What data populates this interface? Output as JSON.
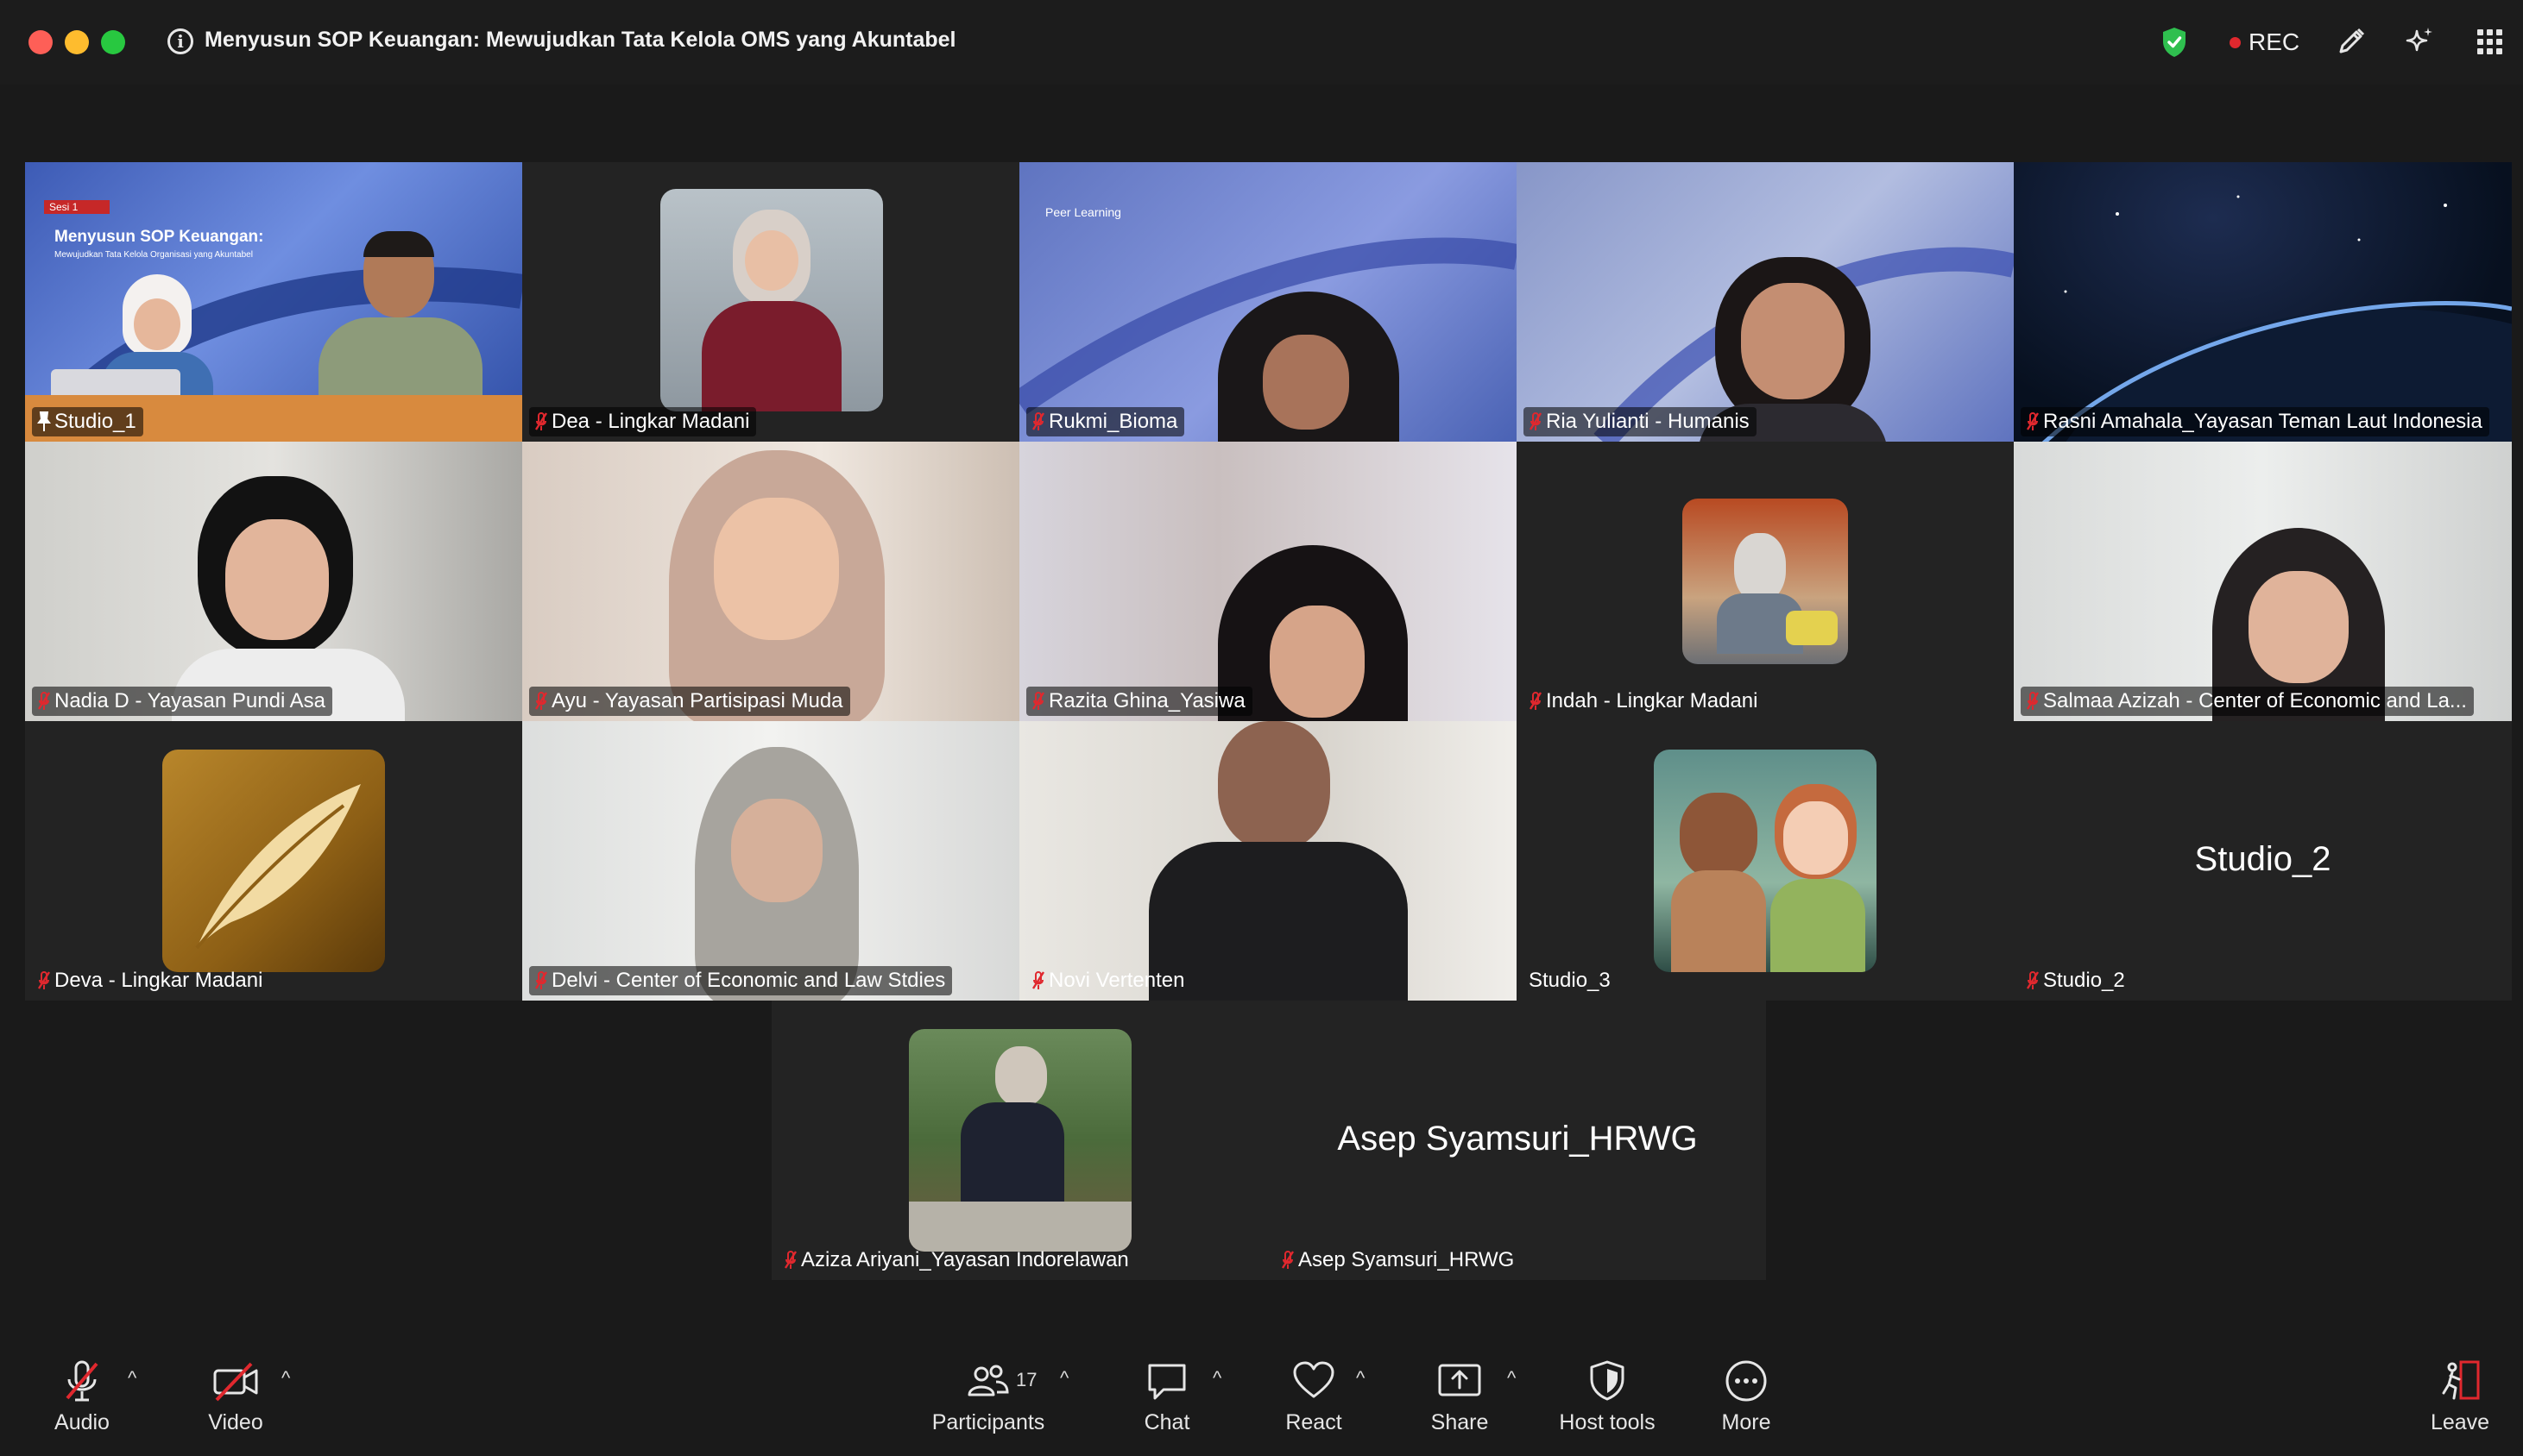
{
  "window": {
    "title": "Menyusun SOP Keuangan: Mewujudkan Tata Kelola OMS yang Akuntabel",
    "rec_label": "REC"
  },
  "participants": [
    {
      "name": "Studio_1",
      "muted": false,
      "pinned": true
    },
    {
      "name": "Dea - Lingkar Madani",
      "muted": true
    },
    {
      "name": "Rukmi_Bioma",
      "muted": true
    },
    {
      "name": "Ria Yulianti - Humanis",
      "muted": true
    },
    {
      "name": "Rasni Amahala_Yayasan Teman Laut Indonesia",
      "muted": true
    },
    {
      "name": "Nadia D - Yayasan Pundi Asa",
      "muted": true
    },
    {
      "name": "Ayu - Yayasan Partisipasi Muda",
      "muted": true
    },
    {
      "name": "Razita Ghina_Yasiwa",
      "muted": true
    },
    {
      "name": "Indah - Lingkar Madani",
      "muted": true
    },
    {
      "name": "Salmaa Azizah - Center of Economic and La...",
      "muted": true
    },
    {
      "name": "Deva - Lingkar Madani",
      "muted": true
    },
    {
      "name": "Delvi - Center of Economic and Law Stdies",
      "muted": true
    },
    {
      "name": "Novi Vertenten",
      "muted": true
    },
    {
      "name": "Studio_3",
      "muted": false
    },
    {
      "name": "Studio_2",
      "muted": true,
      "display_name": "Studio_2"
    },
    {
      "name": "Aziza Ariyani_Yayasan Indorelawan",
      "muted": true
    },
    {
      "name": "Asep Syamsuri_HRWG",
      "muted": true,
      "display_name": "Asep Syamsuri_HRWG"
    }
  ],
  "slides": {
    "studio1_session": "Sesi 1",
    "studio1_heading": "Menyusun SOP Keuangan:",
    "studio1_sub": "Mewujudkan Tata Kelola Organisasi yang Akuntabel",
    "peer_learning": "Peer Learning"
  },
  "toolbar": {
    "audio": "Audio",
    "video": "Video",
    "participants": "Participants",
    "participants_count": "17",
    "chat": "Chat",
    "react": "React",
    "share": "Share",
    "host_tools": "Host tools",
    "more": "More",
    "leave": "Leave",
    "caret": "^"
  },
  "colors": {
    "active_speaker": "#4fd44d",
    "muted_red": "#e0282e",
    "leave_red": "#e0282e",
    "shield_green": "#2fbf4f"
  }
}
